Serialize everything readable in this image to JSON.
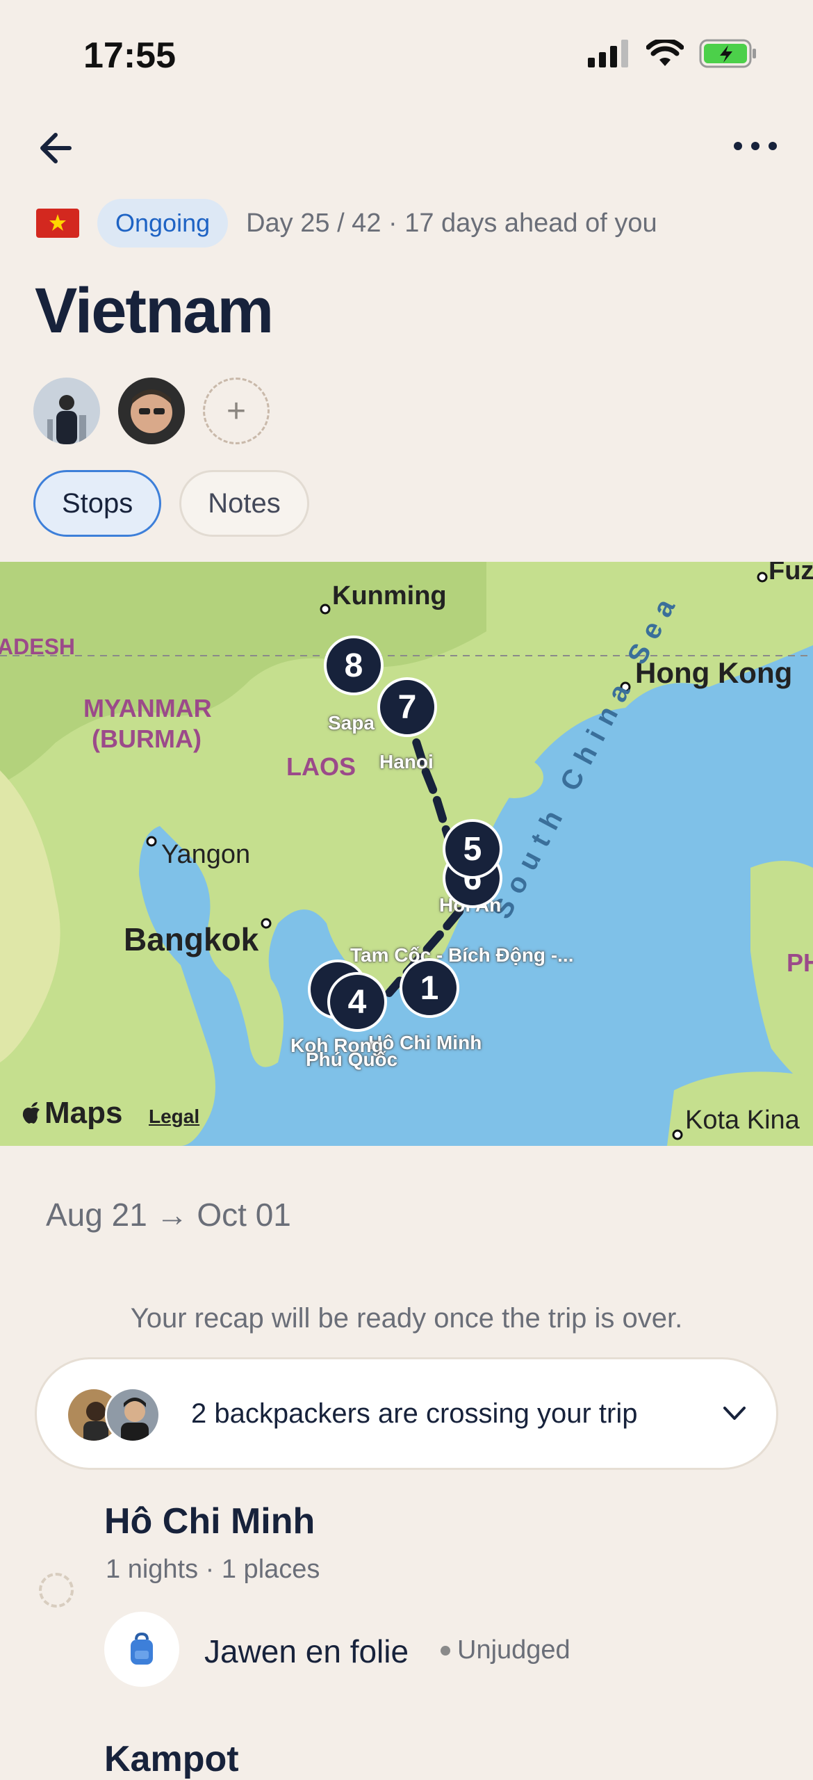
{
  "status": {
    "time": "17:55"
  },
  "header": {
    "status_pill": "Ongoing",
    "day_info": "Day 25 / 42 · 17 days ahead of you",
    "title": "Vietnam",
    "add_label": "+"
  },
  "tabs": [
    {
      "label": "Stops",
      "active": true
    },
    {
      "label": "Notes",
      "active": false
    }
  ],
  "map": {
    "labels": {
      "kunming": "Kunming",
      "hong_kong": "Hong Kong",
      "myanmar": "MYANMAR",
      "burma": "(BURMA)",
      "laos": "LAOS",
      "yangon": "Yangon",
      "bangkok": "Bangkok",
      "south_china_sea": "South China Sea",
      "adesh": "ADESH",
      "fuz": "Fuz",
      "ph": "PH",
      "kota": "Kota Kina"
    },
    "stops": [
      {
        "number": "1",
        "label": "Hô Chi Minh"
      },
      {
        "number": "4",
        "label": "Koh Rong"
      },
      {
        "number": "5",
        "label": "Hoi An"
      },
      {
        "number": "6",
        "label": "Hoi An"
      },
      {
        "number": "7",
        "label": "Hanoi"
      },
      {
        "number": "8",
        "label": "Sapa"
      }
    ],
    "extra_labels": {
      "tam_coc": "Tam Cốc - Bích Động -...",
      "phu_quoc": "Phú Quốc"
    },
    "attribution": "Maps",
    "legal": "Legal"
  },
  "trip": {
    "start": "Aug 21",
    "arrow": "→",
    "end": "Oct 01",
    "recap_text": "Your recap will be ready once the trip is over.",
    "crossing_text": "2 backpackers are crossing your trip"
  },
  "stops_list": [
    {
      "city": "Hô Chi Minh",
      "sub": "1 nights · 1 places",
      "place": {
        "name": "Jawen en folie",
        "status": "Unjudged"
      }
    },
    {
      "city": "Kampot"
    }
  ]
}
